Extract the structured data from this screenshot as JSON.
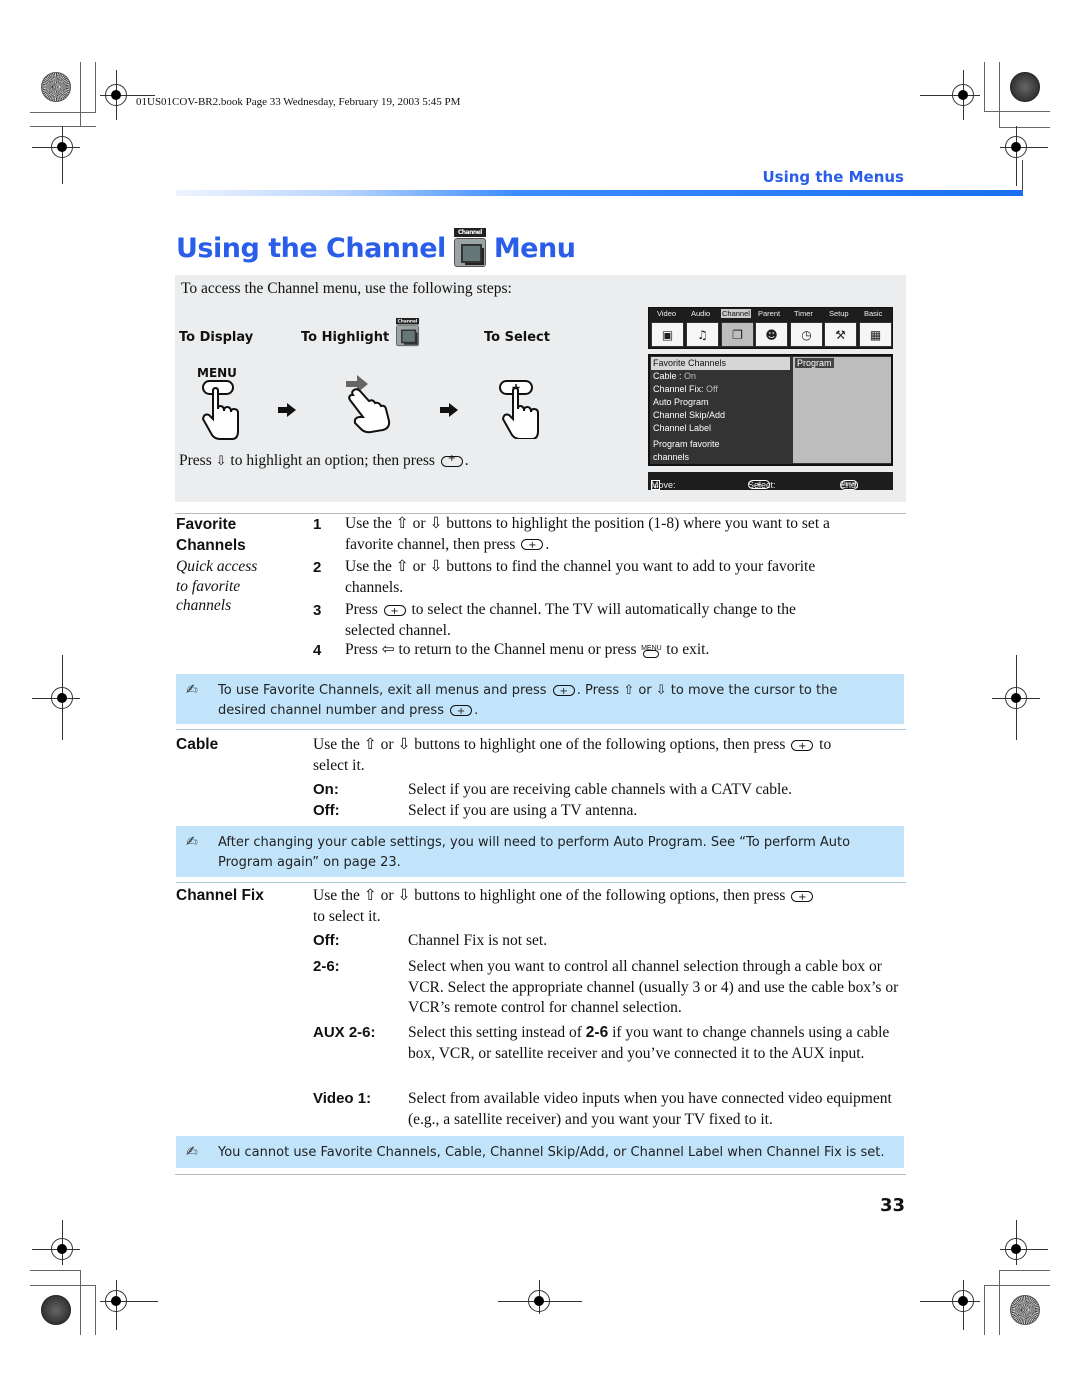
{
  "slug": "01US01COV-BR2.book  Page 33  Wednesday, February 19, 2003  5:45 PM",
  "header": {
    "running_head": "Using the Menus",
    "title_before": "Using the Channel",
    "title_icon_label": "Channel",
    "title_after": "Menu",
    "accent_color": "#2a5ee8"
  },
  "steps": {
    "intro": "To access the Channel menu, use the following steps:",
    "to_display": "To Display",
    "to_highlight": "To Highlight",
    "to_select": "To Select",
    "menu_button_label": "MENU",
    "footer_before": "Press",
    "footer_middle": "to highlight an option; then press",
    "footer_after": "."
  },
  "osd": {
    "tabs": [
      "Video",
      "Audio",
      "Channel",
      "Parent",
      "Timer",
      "Setup",
      "Basic"
    ],
    "active_tab": "Channel",
    "items": [
      {
        "label": "Favorite Channels",
        "value": ""
      },
      {
        "label": "Cable : ",
        "value": "On"
      },
      {
        "label": "Channel Fix: ",
        "value": "Off"
      },
      {
        "label": "Auto Program",
        "value": ""
      },
      {
        "label": "Channel Skip/Add",
        "value": ""
      },
      {
        "label": "Channel Label",
        "value": ""
      },
      {
        "label": "Program favorite",
        "value": ""
      },
      {
        "label": "channels",
        "value": ""
      }
    ],
    "right_label": "Program",
    "bar_move": "Move:",
    "bar_select": "Select:",
    "bar_end": "End:",
    "end_btn": "MENU"
  },
  "favorite": {
    "title_line1": "Favorite",
    "title_line2": "Channels",
    "subtitle": [
      "Quick access",
      "to favorite",
      "channels"
    ],
    "steps": [
      {
        "n": "1",
        "l1": "Use the ⇧ or ⇩ buttons to highlight the position (1-8) where you want to set a",
        "l2": "favorite channel, then press"
      },
      {
        "n": "2",
        "l1": "Use the ⇧ or ⇩ buttons to find the channel you want to add to your favorite",
        "l2": "channels."
      },
      {
        "n": "3",
        "l1a": "Press",
        "l1b": "to select the channel. The TV will automatically change to the",
        "l2": "selected channel."
      },
      {
        "n": "4",
        "l1a": "Press ⇦ to return to the Channel menu or press",
        "l1b": "to exit."
      }
    ],
    "note_a": "To use Favorite Channels, exit all menus and press",
    "note_b": ". Press ⇧ or ⇩ to move the cursor to the",
    "note_c": "desired channel number and press",
    "note_d": "."
  },
  "cable": {
    "title": "Cable",
    "intro_l1": "Use the ⇧ or ⇩ buttons to highlight one of the following options, then press",
    "intro_l1_end": "to",
    "intro_l2": "select it.",
    "options": [
      {
        "label": "On:",
        "text": "Select if you are receiving cable channels with a CATV cable."
      },
      {
        "label": "Off:",
        "text": "Select if you are using a TV antenna."
      }
    ],
    "note_l1": "After changing your cable settings, you will need to perform Auto Program. See “To perform Auto",
    "note_l2": "Program again” on page 23."
  },
  "channel_fix": {
    "title": "Channel Fix",
    "intro_l1": "Use the ⇧ or ⇩ buttons to highlight one of the following options, then press",
    "intro_l2": "to select it.",
    "options": [
      {
        "label": "Off:",
        "text": "Channel Fix is not set."
      },
      {
        "label": "2-6:",
        "text": "Select when you want to control all channel selection through a cable box or VCR. Select the appropriate channel (usually 3 or 4) and use the cable box’s or VCR’s remote control for channel selection."
      },
      {
        "label": "AUX 2-6:",
        "text_a": "Select this setting instead of",
        "text_bold": "2-6",
        "text_b": "if you want to change channels using a cable box, VCR, or satellite receiver and you’ve connected it to the AUX input."
      },
      {
        "label": "Video 1:",
        "text": "Select from available video inputs when you have connected video equipment (e.g., a satellite receiver) and you want your TV fixed to it."
      }
    ],
    "note": "You cannot use Favorite Channels, Cable, Channel Skip/Add, or Channel Label when Channel Fix is set."
  },
  "page_number": "33"
}
